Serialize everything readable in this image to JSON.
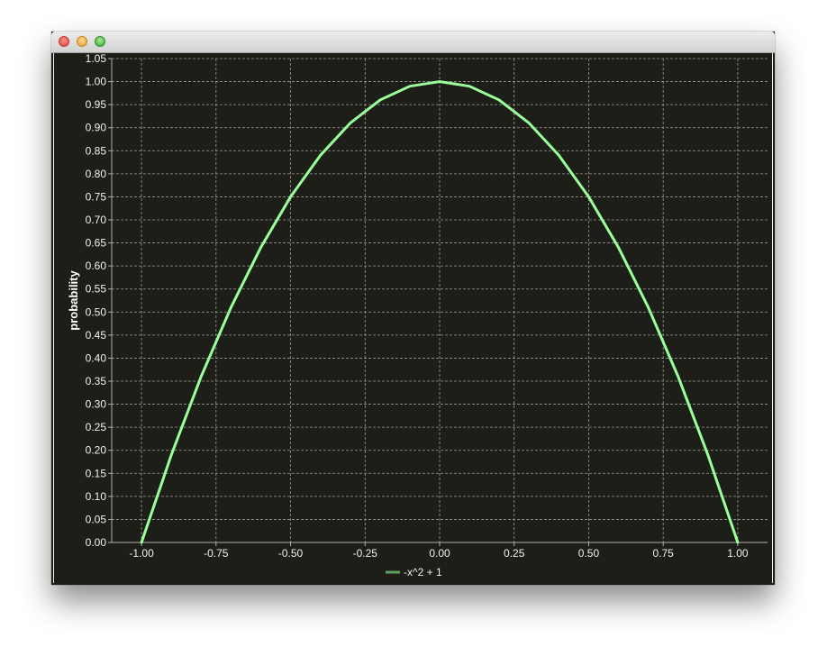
{
  "window": {
    "title": ""
  },
  "icons": [
    "close-button-icon",
    "minimize-button-icon",
    "zoom-button-icon"
  ],
  "colors": {
    "background": "#1e1e19",
    "grid": "#9a9a92",
    "axis": "#b0b0a8",
    "text": "#f0f0f0",
    "series": "#99ff99"
  },
  "chart_data": {
    "type": "line",
    "title": "",
    "xlabel": "",
    "ylabel": "probability",
    "xlim": [
      -1.1,
      1.1
    ],
    "ylim": [
      0,
      1.05
    ],
    "xticks": [
      -1.0,
      -0.75,
      -0.5,
      -0.25,
      0.0,
      0.25,
      0.5,
      0.75,
      1.0
    ],
    "xtick_labels": [
      "-1.00",
      "-0.75",
      "-0.50",
      "-0.25",
      "0.00",
      "0.25",
      "0.50",
      "0.75",
      "1.00"
    ],
    "yticks": [
      0,
      0.05,
      0.1,
      0.15,
      0.2,
      0.25,
      0.3,
      0.35,
      0.4,
      0.45,
      0.5,
      0.55,
      0.6,
      0.65,
      0.7,
      0.75,
      0.8,
      0.85,
      0.9,
      0.95,
      1.0,
      1.05
    ],
    "ytick_labels": [
      "0.00",
      "0.05",
      "0.10",
      "0.15",
      "0.20",
      "0.25",
      "0.30",
      "0.35",
      "0.40",
      "0.45",
      "0.50",
      "0.55",
      "0.60",
      "0.65",
      "0.70",
      "0.75",
      "0.80",
      "0.85",
      "0.90",
      "0.95",
      "1.00",
      "1.05"
    ],
    "grid": true,
    "legend_position": "bottom-center",
    "series": [
      {
        "name": "-x^2 + 1",
        "color": "#99ff99",
        "x": [
          -1.0,
          -0.9,
          -0.8,
          -0.7,
          -0.6,
          -0.5,
          -0.4,
          -0.3,
          -0.2,
          -0.1,
          0.0,
          0.1,
          0.2,
          0.3,
          0.4,
          0.5,
          0.6,
          0.7,
          0.8,
          0.9,
          1.0
        ],
        "y": [
          0.0,
          0.19,
          0.36,
          0.51,
          0.64,
          0.75,
          0.84,
          0.91,
          0.96,
          0.99,
          1.0,
          0.99,
          0.96,
          0.91,
          0.84,
          0.75,
          0.64,
          0.51,
          0.36,
          0.19,
          0.0
        ]
      }
    ]
  }
}
